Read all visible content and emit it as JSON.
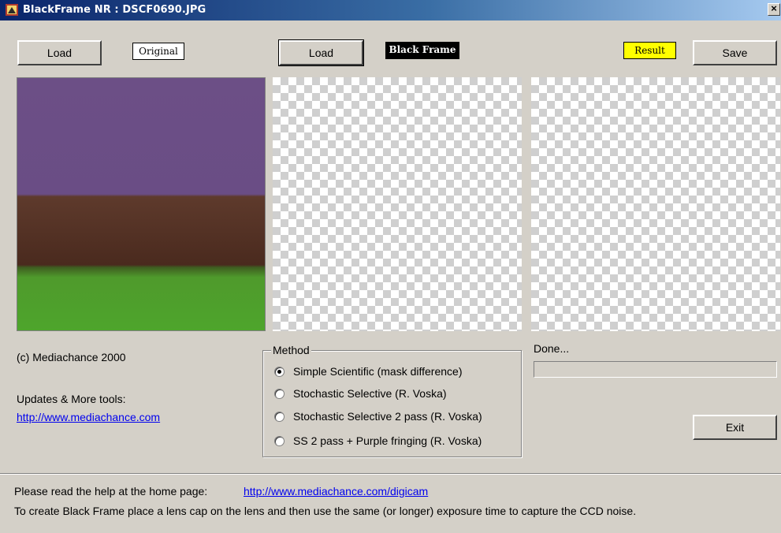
{
  "window": {
    "title": "BlackFrame NR : DSCF0690.JPG",
    "close_label": "×"
  },
  "original": {
    "load_label": "Load",
    "tag_label": "Original"
  },
  "black_frame": {
    "load_label": "Load",
    "tag_label": "Black Frame"
  },
  "result": {
    "tag_label": "Result",
    "save_label": "Save"
  },
  "credits": {
    "copyright": "(c) Mediachance 2000",
    "updates_label": "Updates & More tools:",
    "url": "http://www.mediachance.com"
  },
  "method": {
    "legend": "Method",
    "options": [
      {
        "label": "Simple Scientific (mask difference)",
        "selected": true
      },
      {
        "label": "Stochastic Selective (R. Voska)",
        "selected": false
      },
      {
        "label": "Stochastic Selective  2 pass (R. Voska)",
        "selected": false
      },
      {
        "label": "SS  2 pass + Purple fringing (R. Voska)",
        "selected": false
      }
    ]
  },
  "status": {
    "text": "Done...",
    "progress": 0
  },
  "exit_label": "Exit",
  "footer": {
    "help_text": "Please read the help at the home page:",
    "help_url": "http://www.mediachance.com/digicam",
    "instructions": "To create Black Frame place a lens cap on the lens and then use the same (or longer) exposure time to capture the CCD noise."
  },
  "colors": {
    "titlebar": "#0a246a",
    "face": "#d4d0c8",
    "result_tag": "#ffff00",
    "link": "#0000ee"
  }
}
